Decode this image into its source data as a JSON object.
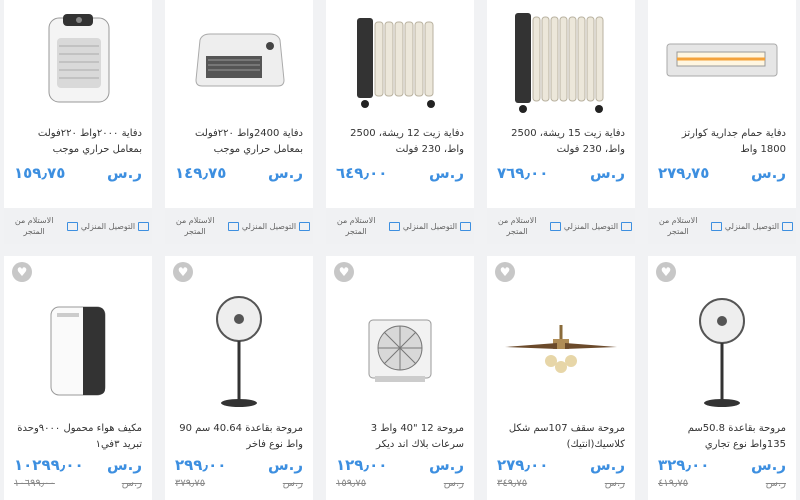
{
  "colors": {
    "accent": "#3d8fe0",
    "background": "#f1f2f4"
  },
  "shipping": {
    "pickup_label": "الاستلام من المتجر",
    "delivery_label": "التوصيل المنزلي"
  },
  "products": [
    {
      "title": "دفاية حمام جدارية كوارتز 1800 واط",
      "currency": "ر.س",
      "price": "٢٧٩٫٧٥",
      "icon": "quartz-heater-icon"
    },
    {
      "title": "دفاية زيت 15 ريشة، 2500 واط، 230 فولت",
      "currency": "ر.س",
      "price": "٧٦٩٫٠٠",
      "icon": "oil-heater-icon"
    },
    {
      "title": "دفاية زيت 12 ريشة، 2500 واط، 230 فولت",
      "currency": "ر.س",
      "price": "٦٤٩٫٠٠",
      "icon": "oil-heater-icon"
    },
    {
      "title": "دفاية 2400واط ٢٢٠فولت بمعامل حراري موجب",
      "currency": "ر.س",
      "price": "١٤٩٫٧٥",
      "icon": "fan-heater-icon"
    },
    {
      "title": "دفاية ٢٠٠٠واط ٢٢٠فولت بمعامل حراري موجب",
      "currency": "ر.س",
      "price": "١٥٩٫٧٥",
      "icon": "fan-heater-icon"
    },
    {
      "title": "مروحة بقاعدة 50.8سم 135واط نوع تجاري",
      "currency": "ر.س",
      "price": "٣٢٩٫٠٠",
      "old_currency": "ر.س",
      "old_price": "٤١٩٫٧٥",
      "icon": "stand-fan-icon"
    },
    {
      "title": "مروحة سقف 107سم شكل كلاسيك(انتيك)",
      "currency": "ر.س",
      "price": "٢٧٩٫٠٠",
      "old_currency": "ر.س",
      "old_price": "٣٤٩٫٧٥",
      "icon": "ceiling-fan-icon"
    },
    {
      "title": "مروحة 12 \"40 واط 3 سرعات بلاك اند ديكر",
      "currency": "ر.س",
      "price": "١٢٩٫٠٠",
      "old_currency": "ر.س",
      "old_price": "١٥٩٫٧٥",
      "icon": "box-fan-icon"
    },
    {
      "title": "مروحة بقاعدة 40.64 سم 90 واط نوع فاخر",
      "currency": "ر.س",
      "price": "٢٩٩٫٠٠",
      "old_currency": "ر.س",
      "old_price": "٣٧٩٫٧٥",
      "icon": "stand-fan-icon"
    },
    {
      "title": "مكيف هواء محمول ٩٠٠٠وحدة تبريد ٣في١",
      "currency": "ر.س",
      "price": "١٠٢٩٩٫٠٠",
      "old_currency": "ر.س",
      "old_price": "١٠٦٩٩٫٠٠",
      "icon": "portable-ac-icon"
    }
  ]
}
